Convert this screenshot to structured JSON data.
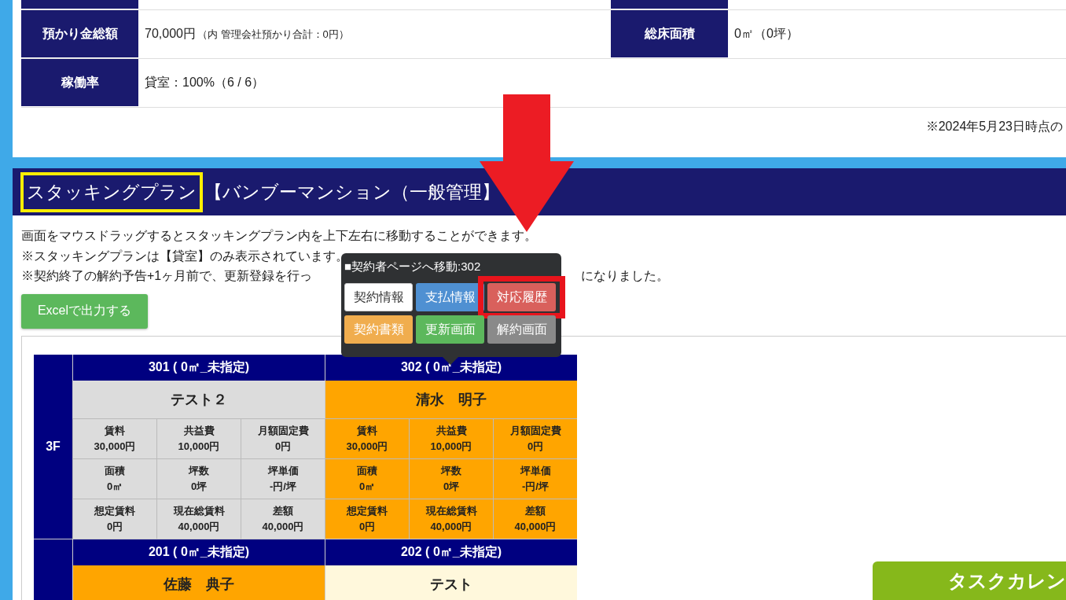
{
  "summary": {
    "rows": [
      {
        "label": "預かり金総額",
        "value": "70,000円",
        "value_note": "（内 管理会社預かり合計：0円）",
        "label_2": "総床面積",
        "value_2": "0㎡（0坪）"
      },
      {
        "label": "稼働率",
        "value": "貸室：100%（6 / 6）"
      }
    ],
    "note": "※2024年5月23日時点の"
  },
  "section": {
    "title": "スタッキングプラン",
    "title_highlighted": true,
    "subtitle": "【バンブーマンション（一般管理】",
    "notes": [
      {
        "text": "画面をマウスドラッグするとスタッキングプラン内を上下左右に移動することができます。"
      },
      {
        "text": "※スタッキングプランは【貸室】のみ表示されています。"
      },
      {
        "text": "※契約終了の解約予告+1ヶ月前で、更新登録を行っ",
        "tail": "になりました。"
      }
    ],
    "export_button": "Excelで出力する"
  },
  "floors": [
    {
      "label": "3F",
      "units": [
        {
          "header": "301 ( 0㎡_未指定)",
          "name": "テスト２",
          "color": "#dcdcdc",
          "cells": [
            {
              "label": "賃料",
              "value": "30,000円"
            },
            {
              "label": "共益費",
              "value": "10,000円"
            },
            {
              "label": "月額固定費",
              "value": "0円"
            },
            {
              "label": "面積",
              "value": "0㎡"
            },
            {
              "label": "坪数",
              "value": "0坪"
            },
            {
              "label": "坪単価",
              "value": "-円/坪"
            },
            {
              "label": "想定賃料",
              "value": "0円"
            },
            {
              "label": "現在総賃料",
              "value": "40,000円"
            },
            {
              "label": "差額",
              "value": "40,000円"
            }
          ]
        },
        {
          "header": "302 ( 0㎡_未指定)",
          "name": "清水　明子",
          "color": "#ffa500",
          "cells": [
            {
              "label": "賃料",
              "value": "30,000円"
            },
            {
              "label": "共益費",
              "value": "10,000円"
            },
            {
              "label": "月額固定費",
              "value": "0円"
            },
            {
              "label": "面積",
              "value": "0㎡"
            },
            {
              "label": "坪数",
              "value": "0坪"
            },
            {
              "label": "坪単価",
              "value": "-円/坪"
            },
            {
              "label": "想定賃料",
              "value": "0円"
            },
            {
              "label": "現在総賃料",
              "value": "40,000円"
            },
            {
              "label": "差額",
              "value": "40,000円"
            }
          ]
        }
      ]
    },
    {
      "units": [
        {
          "header": "201 ( 0㎡_未指定)",
          "name": "佐藤　典子",
          "color": "#ffa500"
        },
        {
          "header": "202 ( 0㎡_未指定)",
          "name": "テスト",
          "color": "#fff8dc"
        }
      ]
    }
  ],
  "popup": {
    "title": "■契約者ページへ移動:302",
    "buttons": [
      {
        "label": "契約情報",
        "color": "#ffffff",
        "highlighted": false
      },
      {
        "label": "支払情報",
        "color": "#4f90d2",
        "highlighted": false
      },
      {
        "label": "対応履歴",
        "color": "#d9605c",
        "highlighted": true
      },
      {
        "label": "契約書類",
        "color": "#f0ad4e",
        "highlighted": false
      },
      {
        "label": "更新画面",
        "color": "#5cb85c",
        "highlighted": false
      },
      {
        "label": "解約画面",
        "color": "#8a8a8a",
        "highlighted": false
      }
    ]
  },
  "task_calendar_button": "タスクカレン"
}
